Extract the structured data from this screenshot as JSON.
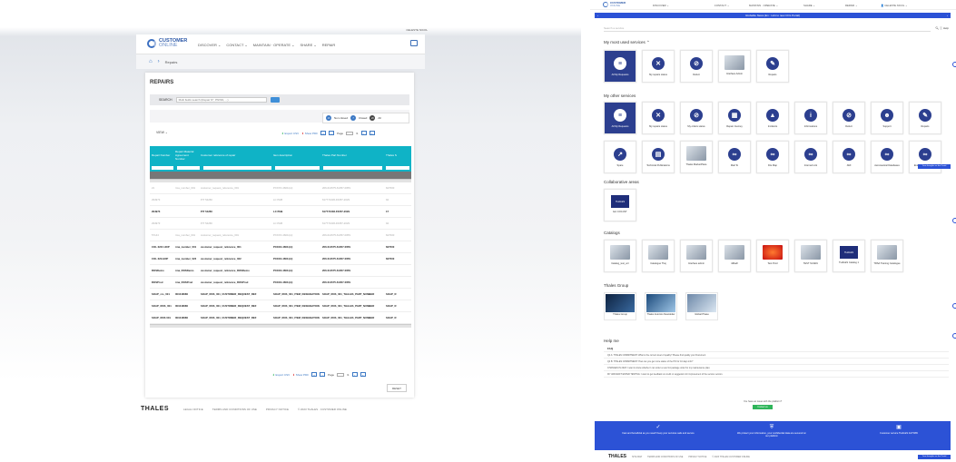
{
  "left": {
    "user_menu": "CELESTE NICOL",
    "logo_top": "CUSTOMER",
    "logo_bottom": "ONLINE",
    "nav": [
      "DISCOVER ⌄",
      "CONTACT ⌄",
      "MAINTAIN · OPERATE ⌄",
      "SHARE ⌄",
      "REPAIR"
    ],
    "breadcrumb": "Repairs",
    "page_title": "REPAIRS",
    "search_label": "SEARCH",
    "search_placeholder": "Multi fields search (Repair N°, PN/SN, ...)",
    "filters": [
      {
        "count": "13",
        "label": "Non closed",
        "color": "#3b78c4"
      },
      {
        "count": "7",
        "label": "Closed",
        "color": "#3b78c4"
      },
      {
        "count": "20",
        "label": "All",
        "color": "#444"
      }
    ],
    "view_label": "VIEW ⌄",
    "export_csv": "Export CSV",
    "show_pdf": "Show PDF",
    "page_label": "Page",
    "page_total": "/1",
    "columns": [
      "Repair Number",
      "Repair Material Agreement Number",
      "Customer reference of repair",
      "Item description",
      "Thales Part Number",
      "Thales S"
    ],
    "rows": [
      {
        "style": "g",
        "cells": [
          "21",
          "rma_number_001",
          "customer_request_reference_001",
          "PXXXX-4600-(H)",
          "206-014575-61357-005S",
          "627000"
        ]
      },
      {
        "style": "g",
        "cells": [
          "294973",
          "",
          "P/T 54260",
          "LC PHB",
          "617772436-F0057-2029",
          "94"
        ]
      },
      {
        "style": "b",
        "cells": [
          "294973",
          "",
          "P/T 54260",
          "LC PHB",
          "617772436-F0057-2029",
          "17"
        ]
      },
      {
        "style": "g",
        "cells": [
          "294973",
          "",
          "P/T 54260",
          "LC PHB",
          "617772436-F0057-2029",
          "94"
        ]
      },
      {
        "style": "g",
        "cells": [
          "57144",
          "rma_number_001",
          "customer_request_reference_001",
          "PXXXX-4600-(H)",
          "206-014575-61357-005S",
          "627000"
        ]
      },
      {
        "style": "b",
        "cells": [
          "COL 2221 HOP",
          "rma_number_001",
          "customer_request_reference_001",
          "PXXXX-4600-(H)",
          "206-014575-61357-005S",
          "627000"
        ]
      },
      {
        "style": "b",
        "cells": [
          "COL 222-HOP",
          "rma_number_022",
          "customer_request_reference_022",
          "PXXXX-4600-(H)",
          "206-014575-61357-005S",
          "627000"
        ]
      },
      {
        "style": "b",
        "cells": [
          "ROSDemo",
          "rma_ROSDemo",
          "customer_request_reference_ROSDemo",
          "PXXXX-4600-(H)",
          "206-014575-61357-005S",
          ""
        ]
      },
      {
        "style": "b",
        "cells": [
          "ROSProd",
          "rma_ROSProd",
          "customer_request_reference_ROSProd",
          "PXXXX-4600-(H)",
          "206-014575-61357-005S",
          ""
        ]
      },
      {
        "style": "b",
        "cells": [
          "SOAP_rcs_001",
          "001018080",
          "SOAP_ROS_001_CUSTOMER_REQUEST_REF",
          "SOAP_ROS_001_ITEM_DESIGNATION",
          "SOAP_ROS_001_THALES_PART_NUMBER",
          "SOAP_R"
        ]
      },
      {
        "style": "b",
        "cells": [
          "SOAP_ROS_001",
          "001018080",
          "SOAP_ROS_001_CUSTOMER_REQUEST_REF",
          "SOAP_ROS_001_ITEM_DESIGNATION",
          "SOAP_ROS_001_THALES_PART_NUMBER",
          "SOAP_R"
        ]
      },
      {
        "style": "b",
        "cells": [
          "SOAP_ROS 001",
          "001018080",
          "SOAP_ROS_001_CUSTOMER_REQUEST_REF",
          "SOAP_ROS_001_ITEM_DESIGNATION",
          "SOAP_ROS_001_THALES_PART_NUMBER",
          "SOAP_R"
        ]
      }
    ],
    "reset": "RESET",
    "footer_logo": "THALES",
    "footer_links": [
      "LEGAL NOTICE",
      "TERMS AND CONDITIONS OF USE",
      "PRIVACY NOTICE",
      "© 2023 THALES · CUSTOMER ONLINE"
    ]
  },
  "right": {
    "logo_top": "CUSTOMER",
    "logo_bottom": "ONLINE",
    "nav": [
      "DISCOVER ⌄",
      "CONTACT ⌄",
      "MAINTAIN · OPERATE ⌄",
      "SHARE ⌄",
      "REPAIR ⌄"
    ],
    "user": "👤 CELESTE NICOL ⌄",
    "news": "Globalite News (En : Link to new COL Portal)",
    "search_placeholder": "Search a service",
    "help": "Help",
    "most_used_title": "My most used services ⌃",
    "most_used": [
      {
        "label": "All My Requests",
        "glyph": "≡",
        "sel": true
      },
      {
        "label": "My repairs status",
        "glyph": "✕"
      },
      {
        "label": "Defect",
        "glyph": "⊘"
      },
      {
        "label": "Interface Admin",
        "img": true
      },
      {
        "label": "Repairs",
        "glyph": "✎"
      }
    ],
    "other_title": "My other services",
    "other_row1": [
      {
        "label": "All My Requests",
        "glyph": "≡",
        "sel": true
      },
      {
        "label": "My repairs status",
        "glyph": "✕"
      },
      {
        "label": "My orders status",
        "glyph": "⊘"
      },
      {
        "label": "Repair Journey",
        "glyph": "▦"
      },
      {
        "label": "Incidents",
        "glyph": "▲"
      },
      {
        "label": "Informations",
        "glyph": "i"
      },
      {
        "label": "Defect",
        "glyph": "⊘"
      },
      {
        "label": "Support",
        "glyph": "☻"
      },
      {
        "label": "Repairs",
        "glyph": "✎"
      }
    ],
    "other_row2": [
      {
        "label": "Spare",
        "glyph": "↗"
      },
      {
        "label": "Technical Publications",
        "glyph": "▤"
      },
      {
        "label": "Thales MarketPlace",
        "img": true
      },
      {
        "label": "Mail To",
        "glyph": "∞"
      },
      {
        "label": "File Map",
        "glyph": "∞"
      },
      {
        "label": "Internal Link",
        "glyph": "∞"
      },
      {
        "label": "AMI",
        "glyph": "∞"
      },
      {
        "label": "Aeronautical Databases",
        "glyph": "∞"
      },
      {
        "label": "External Service Test REPAIR",
        "glyph": "∞"
      }
    ],
    "collab_title": "Collaborative areas",
    "collab": [
      {
        "label": "Ext COC-INT",
        "thumb": "THALES"
      }
    ],
    "catalog_title": "Catalogs",
    "catalog": [
      {
        "label": "Catalog_test_ocr"
      },
      {
        "label": "Catalogue Thej"
      },
      {
        "label": "Interface admin"
      },
      {
        "label": "idRadl"
      },
      {
        "label": "Test Prod",
        "red": true
      },
      {
        "label": "TEST SCADU"
      },
      {
        "label": "THALES Catalog 1",
        "thumb": "THALES"
      },
      {
        "label": "TRSA Training Catalogue"
      }
    ],
    "group_title": "Thales Group",
    "group": [
      "Thales Group",
      "Thales Avionics Newsletter",
      "Global Phase"
    ],
    "help_title": "Help me",
    "faq_title": "FAQ",
    "faq": [
      "Q4 A: THALES COMMITMENT: What is the current level of quality? Please find quality your Document",
      "Q4 B: THALES COMMITMENT: How can you get more status of the PO for 10 days info?",
      "CHANGES IN 2023: I want to know whether I can order a new 9 A package order for my maintenance plan.",
      "MY AIRCRAFT ENTER TESTING: I want to get feedback on credit or suggestion for improvement of the service version."
    ],
    "chat_q": "You have an issue with the platform?",
    "chat_btn": "Contact us",
    "band": [
      {
        "icon": "✓",
        "text": "Fast and beneficial as you need! Keep your services safe and secure"
      },
      {
        "icon": "⛨",
        "text": "We protect your information, your confidential data are secured on our platform"
      },
      {
        "icon": "▣",
        "text": "Customer service THALES 24/7/365"
      }
    ],
    "footer_logo": "THALES",
    "footer_links": [
      "SITE MAP",
      "TERMS AND CONDITIONS OF USE",
      "PRIVACY NOTICE",
      "© 2023 THALES CUSTOMER ONLINE"
    ],
    "feedback": "Your thoughts on the Portal"
  }
}
